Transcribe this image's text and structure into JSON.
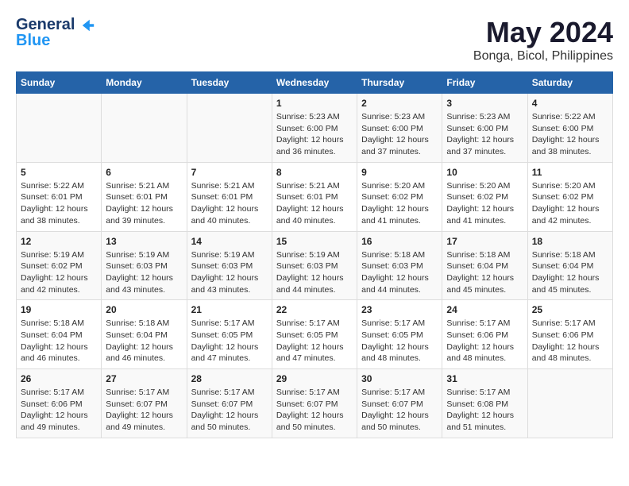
{
  "header": {
    "logo_line1": "General",
    "logo_line2": "Blue",
    "title": "May 2024",
    "subtitle": "Bonga, Bicol, Philippines"
  },
  "days_of_week": [
    "Sunday",
    "Monday",
    "Tuesday",
    "Wednesday",
    "Thursday",
    "Friday",
    "Saturday"
  ],
  "weeks": [
    [
      {
        "day": "",
        "info": ""
      },
      {
        "day": "",
        "info": ""
      },
      {
        "day": "",
        "info": ""
      },
      {
        "day": "1",
        "info": "Sunrise: 5:23 AM\nSunset: 6:00 PM\nDaylight: 12 hours\nand 36 minutes."
      },
      {
        "day": "2",
        "info": "Sunrise: 5:23 AM\nSunset: 6:00 PM\nDaylight: 12 hours\nand 37 minutes."
      },
      {
        "day": "3",
        "info": "Sunrise: 5:23 AM\nSunset: 6:00 PM\nDaylight: 12 hours\nand 37 minutes."
      },
      {
        "day": "4",
        "info": "Sunrise: 5:22 AM\nSunset: 6:00 PM\nDaylight: 12 hours\nand 38 minutes."
      }
    ],
    [
      {
        "day": "5",
        "info": "Sunrise: 5:22 AM\nSunset: 6:01 PM\nDaylight: 12 hours\nand 38 minutes."
      },
      {
        "day": "6",
        "info": "Sunrise: 5:21 AM\nSunset: 6:01 PM\nDaylight: 12 hours\nand 39 minutes."
      },
      {
        "day": "7",
        "info": "Sunrise: 5:21 AM\nSunset: 6:01 PM\nDaylight: 12 hours\nand 40 minutes."
      },
      {
        "day": "8",
        "info": "Sunrise: 5:21 AM\nSunset: 6:01 PM\nDaylight: 12 hours\nand 40 minutes."
      },
      {
        "day": "9",
        "info": "Sunrise: 5:20 AM\nSunset: 6:02 PM\nDaylight: 12 hours\nand 41 minutes."
      },
      {
        "day": "10",
        "info": "Sunrise: 5:20 AM\nSunset: 6:02 PM\nDaylight: 12 hours\nand 41 minutes."
      },
      {
        "day": "11",
        "info": "Sunrise: 5:20 AM\nSunset: 6:02 PM\nDaylight: 12 hours\nand 42 minutes."
      }
    ],
    [
      {
        "day": "12",
        "info": "Sunrise: 5:19 AM\nSunset: 6:02 PM\nDaylight: 12 hours\nand 42 minutes."
      },
      {
        "day": "13",
        "info": "Sunrise: 5:19 AM\nSunset: 6:03 PM\nDaylight: 12 hours\nand 43 minutes."
      },
      {
        "day": "14",
        "info": "Sunrise: 5:19 AM\nSunset: 6:03 PM\nDaylight: 12 hours\nand 43 minutes."
      },
      {
        "day": "15",
        "info": "Sunrise: 5:19 AM\nSunset: 6:03 PM\nDaylight: 12 hours\nand 44 minutes."
      },
      {
        "day": "16",
        "info": "Sunrise: 5:18 AM\nSunset: 6:03 PM\nDaylight: 12 hours\nand 44 minutes."
      },
      {
        "day": "17",
        "info": "Sunrise: 5:18 AM\nSunset: 6:04 PM\nDaylight: 12 hours\nand 45 minutes."
      },
      {
        "day": "18",
        "info": "Sunrise: 5:18 AM\nSunset: 6:04 PM\nDaylight: 12 hours\nand 45 minutes."
      }
    ],
    [
      {
        "day": "19",
        "info": "Sunrise: 5:18 AM\nSunset: 6:04 PM\nDaylight: 12 hours\nand 46 minutes."
      },
      {
        "day": "20",
        "info": "Sunrise: 5:18 AM\nSunset: 6:04 PM\nDaylight: 12 hours\nand 46 minutes."
      },
      {
        "day": "21",
        "info": "Sunrise: 5:17 AM\nSunset: 6:05 PM\nDaylight: 12 hours\nand 47 minutes."
      },
      {
        "day": "22",
        "info": "Sunrise: 5:17 AM\nSunset: 6:05 PM\nDaylight: 12 hours\nand 47 minutes."
      },
      {
        "day": "23",
        "info": "Sunrise: 5:17 AM\nSunset: 6:05 PM\nDaylight: 12 hours\nand 48 minutes."
      },
      {
        "day": "24",
        "info": "Sunrise: 5:17 AM\nSunset: 6:06 PM\nDaylight: 12 hours\nand 48 minutes."
      },
      {
        "day": "25",
        "info": "Sunrise: 5:17 AM\nSunset: 6:06 PM\nDaylight: 12 hours\nand 48 minutes."
      }
    ],
    [
      {
        "day": "26",
        "info": "Sunrise: 5:17 AM\nSunset: 6:06 PM\nDaylight: 12 hours\nand 49 minutes."
      },
      {
        "day": "27",
        "info": "Sunrise: 5:17 AM\nSunset: 6:07 PM\nDaylight: 12 hours\nand 49 minutes."
      },
      {
        "day": "28",
        "info": "Sunrise: 5:17 AM\nSunset: 6:07 PM\nDaylight: 12 hours\nand 50 minutes."
      },
      {
        "day": "29",
        "info": "Sunrise: 5:17 AM\nSunset: 6:07 PM\nDaylight: 12 hours\nand 50 minutes."
      },
      {
        "day": "30",
        "info": "Sunrise: 5:17 AM\nSunset: 6:07 PM\nDaylight: 12 hours\nand 50 minutes."
      },
      {
        "day": "31",
        "info": "Sunrise: 5:17 AM\nSunset: 6:08 PM\nDaylight: 12 hours\nand 51 minutes."
      },
      {
        "day": "",
        "info": ""
      }
    ]
  ]
}
